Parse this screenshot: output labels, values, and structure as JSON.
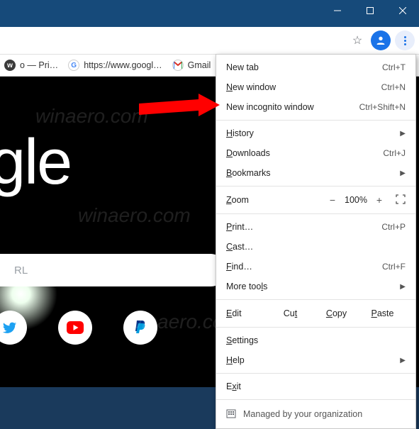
{
  "bookmarks": {
    "winaero": "o — Pri…",
    "google_url": "https://www.googl…",
    "gmail": "Gmail"
  },
  "page": {
    "logo": "oogle",
    "search_placeholder": "RL"
  },
  "menu": {
    "new_tab": "New tab",
    "new_tab_sc": "Ctrl+T",
    "new_window": "ew window",
    "new_window_sc": "Ctrl+N",
    "new_incognito": "New incognito window",
    "new_incognito_sc": "Ctrl+Shift+N",
    "history": "istory",
    "downloads": "ownloads",
    "downloads_sc": "Ctrl+J",
    "bookmarks": "ookmarks",
    "zoom": "oom",
    "zoom_value": "100%",
    "print": "rint…",
    "print_sc": "Ctrl+P",
    "cast": "ast…",
    "find": "ind…",
    "find_sc": "Ctrl+F",
    "more_tools": "More too",
    "more_tools_suffix": "s",
    "edit": "dit",
    "cut": "Cu",
    "copy": "opy",
    "paste": "aste",
    "settings": "ettings",
    "help": "elp",
    "exit": "it",
    "managed": "Managed by your organization"
  },
  "watermark": "winaero.com"
}
